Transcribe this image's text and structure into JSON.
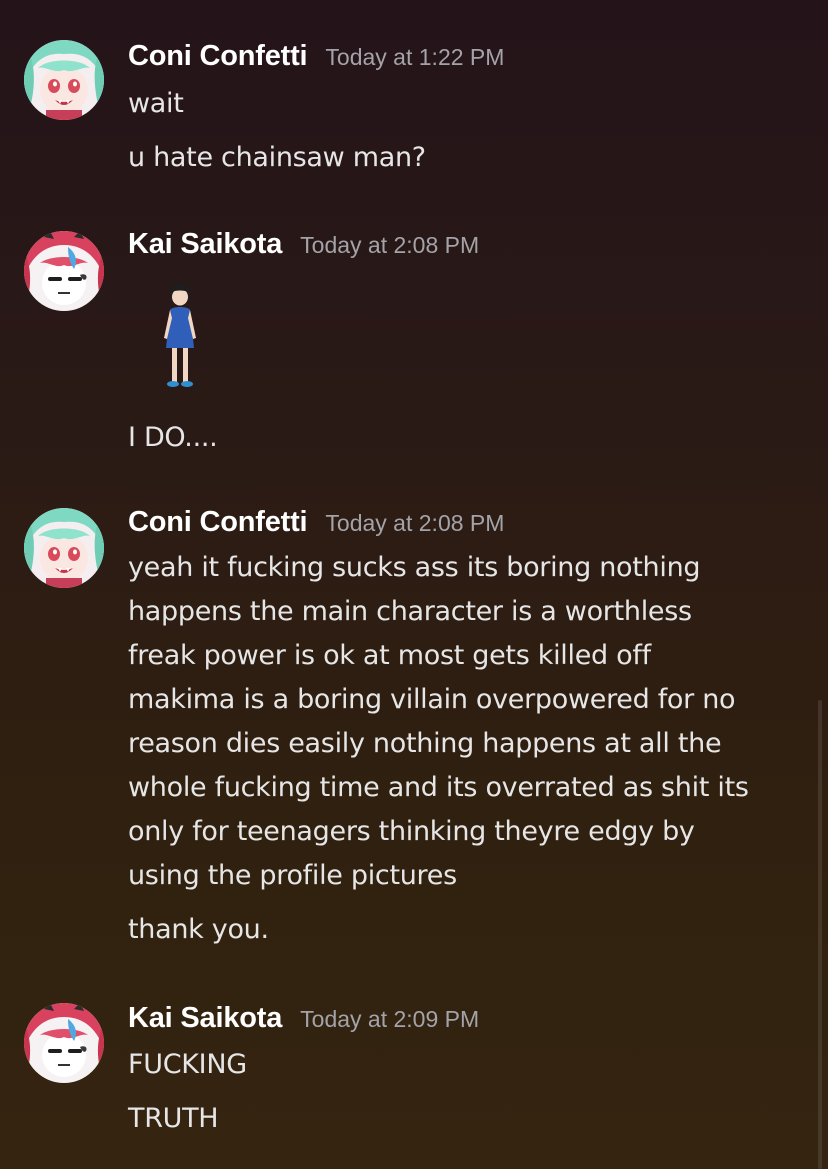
{
  "messages": [
    {
      "author": "Coni Confetti",
      "timestamp": "Today at 1:22 PM",
      "avatar_icon": "anime-girl-green-hair-avatar",
      "lines": [
        "wait",
        "u hate chainsaw man?"
      ]
    },
    {
      "author": "Kai Saikota",
      "timestamp": "Today at 2:08 PM",
      "avatar_icon": "anime-girl-red-hair-avatar",
      "emoji": "standing-woman-emoji",
      "lines": [
        "I DO...."
      ]
    },
    {
      "author": "Coni Confetti",
      "timestamp": "Today at 2:08 PM",
      "avatar_icon": "anime-girl-green-hair-avatar",
      "paragraph": [
        "yeah it fucking sucks ass its boring nothing",
        "happens the main character is a worthless",
        "freak power is ok at most gets killed off",
        "makima is a boring villain overpowered for no",
        "reason dies easily nothing happens at all the",
        "whole fucking time and its overrated as shit its",
        "only for teenagers thinking theyre edgy by",
        "using the profile pictures"
      ],
      "lines": [
        "thank you."
      ]
    },
    {
      "author": "Kai Saikota",
      "timestamp": "Today at 2:09 PM",
      "avatar_icon": "anime-girl-red-hair-avatar",
      "lines": [
        "FUCKING",
        "TRUTH"
      ]
    }
  ],
  "colors": {
    "author": "#ffffff",
    "timestamp": "#a3a3a8",
    "text": "#e6e6e6",
    "background_top": "#241319",
    "background_bottom": "#342410"
  }
}
